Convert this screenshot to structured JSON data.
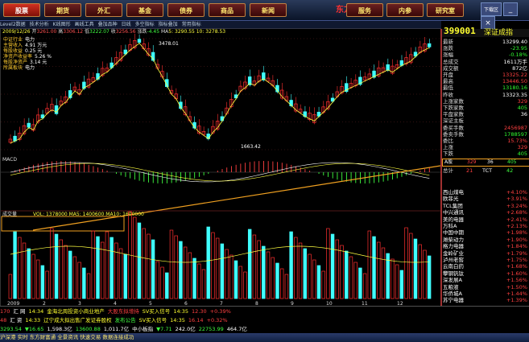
{
  "menu": {
    "items": [
      "股票",
      "期货",
      "外汇",
      "基金",
      "债券",
      "商品",
      "新闻",
      "服务",
      "内参",
      "研究室"
    ],
    "active_index": 0,
    "brand": "东方财富通",
    "window_buttons": [
      "下载区",
      "_",
      "×"
    ]
  },
  "toolbar": {
    "items": [
      "Level2数据",
      "技术分析",
      "K线图形",
      "画线工具",
      "叠加品种",
      "日线",
      "多空指标",
      "指标叠加",
      "常用指标"
    ]
  },
  "ohlc_line": {
    "date": "2009/12/26",
    "open_label": "开",
    "open": "3261.00",
    "high_label": "高",
    "high": "3306.12",
    "low_label": "低",
    "low": "3222.07",
    "close_label": "收",
    "close": "3256.56",
    "change_label": "涨跌",
    "change": "-4.45",
    "ma_label": "MA",
    "ma": "5: 3290.55  10: 3278.53"
  },
  "info": [
    {
      "label": "中证行业",
      "value": "电力"
    },
    {
      "label": "主营收入",
      "value": "4.91 万元"
    },
    {
      "label": "每股收益",
      "value": "0.25 元"
    },
    {
      "label": "净资产收益率",
      "value": "5.26 %"
    },
    {
      "label": "每股净资产",
      "value": "3.14 元"
    },
    {
      "label": "所属板块",
      "value": "电力"
    }
  ],
  "chart_labels": {
    "high_point": "3478.01",
    "low_point": "1663.42",
    "volume_title": "成交量",
    "volume_vals": "VOL: 1378000  MA5: 1400600  MA10: 1600000",
    "x_ticks": [
      "2009",
      "2",
      "3",
      "4",
      "5",
      "6",
      "7",
      "8",
      "9",
      "10",
      "11",
      "12"
    ],
    "macd_label": "MACD"
  },
  "right_panel": {
    "code": "399001",
    "name": "深证成指",
    "rows": [
      {
        "label": "最新",
        "value": "13299.40",
        "cls": "w"
      },
      {
        "label": "涨跌",
        "value": "-23.95",
        "cls": "g"
      },
      {
        "label": "涨幅",
        "value": "-0.18%",
        "cls": "g"
      },
      {
        "label": "总成交",
        "value": "1611万手",
        "cls": "w"
      },
      {
        "label": "成交额",
        "value": "872亿",
        "cls": "w"
      },
      {
        "label": "开盘",
        "value": "13325.22",
        "cls": "r"
      },
      {
        "label": "最高",
        "value": "13446.50",
        "cls": "r"
      },
      {
        "label": "最低",
        "value": "13180.16",
        "cls": "g"
      },
      {
        "label": "昨收",
        "value": "13323.35",
        "cls": "w"
      },
      {
        "label": "上涨家数",
        "value": "329",
        "cls": "r"
      },
      {
        "label": "下跌家数",
        "value": "405",
        "cls": "g"
      },
      {
        "label": "平盘家数",
        "value": "36",
        "cls": "w"
      },
      {
        "label": "深证主板",
        "value": "",
        "cls": "w"
      },
      {
        "label": "委买手数",
        "value": "2456987",
        "cls": "r"
      },
      {
        "label": "委卖手数",
        "value": "1788597",
        "cls": "g"
      },
      {
        "label": "委比",
        "value": "15.73%",
        "cls": "r"
      },
      {
        "label": "上涨",
        "value": "329",
        "cls": "r"
      },
      {
        "label": "下跌",
        "value": "405",
        "cls": "g"
      }
    ],
    "hl": {
      "label": "A股",
      "up": "329",
      "flat": "36",
      "down": "405"
    },
    "total_row": {
      "label": "总计",
      "a": "21",
      "b": "TCT",
      "c": "42"
    },
    "sectors": [
      {
        "name": "西山煤电",
        "value": "+4.10%"
      },
      {
        "name": "欧菲光",
        "value": "+3.91%"
      },
      {
        "name": "TCL集团",
        "value": "+3.24%"
      },
      {
        "name": "中兴通讯",
        "value": "+2.68%"
      },
      {
        "name": "美的电器",
        "value": "+2.41%"
      },
      {
        "name": "万科A",
        "value": "+2.13%"
      },
      {
        "name": "中国中期",
        "value": "+1.98%"
      },
      {
        "name": "潍柴动力",
        "value": "+1.90%"
      },
      {
        "name": "格力电器",
        "value": "+1.84%"
      },
      {
        "name": "金岭矿业",
        "value": "+1.79%"
      },
      {
        "name": "泸州老窖",
        "value": "+1.75%"
      },
      {
        "name": "云南白药",
        "value": "+1.68%"
      },
      {
        "name": "攀钢钒钛",
        "value": "+1.60%"
      },
      {
        "name": "深发展A",
        "value": "+1.56%"
      },
      {
        "name": "五粮液",
        "value": "+1.50%"
      },
      {
        "name": "华侨城A",
        "value": "+1.44%"
      },
      {
        "name": "苏宁电器",
        "value": "+1.39%"
      }
    ]
  },
  "bottom": {
    "row1": [
      {
        "t": "170",
        "c": "#ff4040"
      },
      {
        "t": "汇 网",
        "c": "#fff"
      },
      {
        "t": "14:34",
        "c": "#ffff30"
      },
      {
        "t": "金海北周投资小商业地产",
        "c": "#ffff30"
      },
      {
        "t": "大股东拟增持",
        "c": "#ff4040"
      },
      {
        "t": "SV买入信号",
        "c": "#ffff30"
      },
      {
        "t": "14:35",
        "c": "#ffff30"
      },
      {
        "t": "12.30",
        "c": "#ff4040"
      },
      {
        "t": "+0.39%",
        "c": "#ff4040"
      }
    ],
    "row2": [
      {
        "t": "48",
        "c": "#ff4040"
      },
      {
        "t": "汇 资",
        "c": "#fff"
      },
      {
        "t": "14:33",
        "c": "#ffff30"
      },
      {
        "t": "辽宁成大拟出售广发证券股权",
        "c": "#ffff30"
      },
      {
        "t": "发布公告",
        "c": "#40ff40"
      },
      {
        "t": "SV买入信号",
        "c": "#ffff30"
      },
      {
        "t": "14:35",
        "c": "#ffff30"
      },
      {
        "t": "16.14",
        "c": "#ff4040"
      },
      {
        "t": "+0.32%",
        "c": "#ff4040"
      }
    ],
    "row3": [
      {
        "t": "3293.54",
        "c": "#40ff40"
      },
      {
        "t": "▼16.65",
        "c": "#40ff40"
      },
      {
        "t": "1,598.3亿",
        "c": "#fff"
      },
      {
        "t": "13600.88",
        "c": "#40ff40"
      },
      {
        "t": "1,011.7亿",
        "c": "#fff"
      },
      {
        "t": "中小板指",
        "c": "#fff"
      },
      {
        "t": "▼7.71",
        "c": "#40ff40"
      },
      {
        "t": "242.0亿",
        "c": "#fff"
      },
      {
        "t": "22753.99",
        "c": "#40ff40"
      },
      {
        "t": "464.7亿",
        "c": "#fff"
      }
    ],
    "status": "沪深港 实时 东方财富通 全景资讯 快速交易  数据连接成功"
  }
}
